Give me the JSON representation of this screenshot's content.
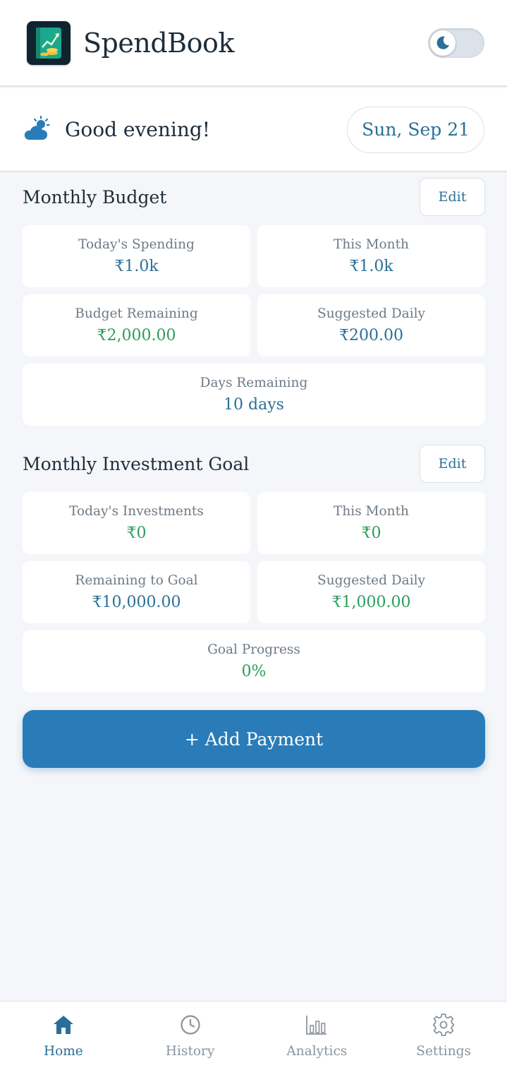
{
  "header": {
    "app_title": "SpendBook",
    "logo_icon": "ledger-growth-icon",
    "theme_toggle_icon": "moon-icon",
    "dark_mode_enabled": false
  },
  "greeting": {
    "icon": "partly-cloudy-icon",
    "text": "Good evening!",
    "date": "Sun, Sep 21"
  },
  "budget": {
    "title": "Monthly Budget",
    "edit_label": "Edit",
    "cards": [
      {
        "label": "Today's Spending",
        "value": "₹1.0k"
      },
      {
        "label": "This Month",
        "value": "₹1.0k"
      },
      {
        "label": "Budget Remaining",
        "value": "₹2,000.00"
      },
      {
        "label": "Suggested Daily",
        "value": "₹200.00"
      },
      {
        "label": "Days Remaining",
        "value": "10 days"
      }
    ]
  },
  "investment": {
    "title": "Monthly Investment Goal",
    "edit_label": "Edit",
    "cards": [
      {
        "label": "Today's Investments",
        "value": "₹0"
      },
      {
        "label": "This Month",
        "value": "₹0"
      },
      {
        "label": "Remaining to Goal",
        "value": "₹10,000.00"
      },
      {
        "label": "Suggested Daily",
        "value": "₹1,000.00"
      },
      {
        "label": "Goal Progress",
        "value": "0%"
      }
    ]
  },
  "add_payment_label": "+ Add Payment",
  "nav": {
    "items": [
      {
        "label": "Home",
        "icon": "home-icon",
        "active": true
      },
      {
        "label": "History",
        "icon": "clock-icon",
        "active": false
      },
      {
        "label": "Analytics",
        "icon": "bar-chart-icon",
        "active": false
      },
      {
        "label": "Settings",
        "icon": "gear-icon",
        "active": false
      }
    ]
  },
  "colors": {
    "primary": "#2a7cb8",
    "value_blue": "#2a6f97",
    "value_green": "#2a9d5c",
    "background": "#f4f6f9"
  }
}
